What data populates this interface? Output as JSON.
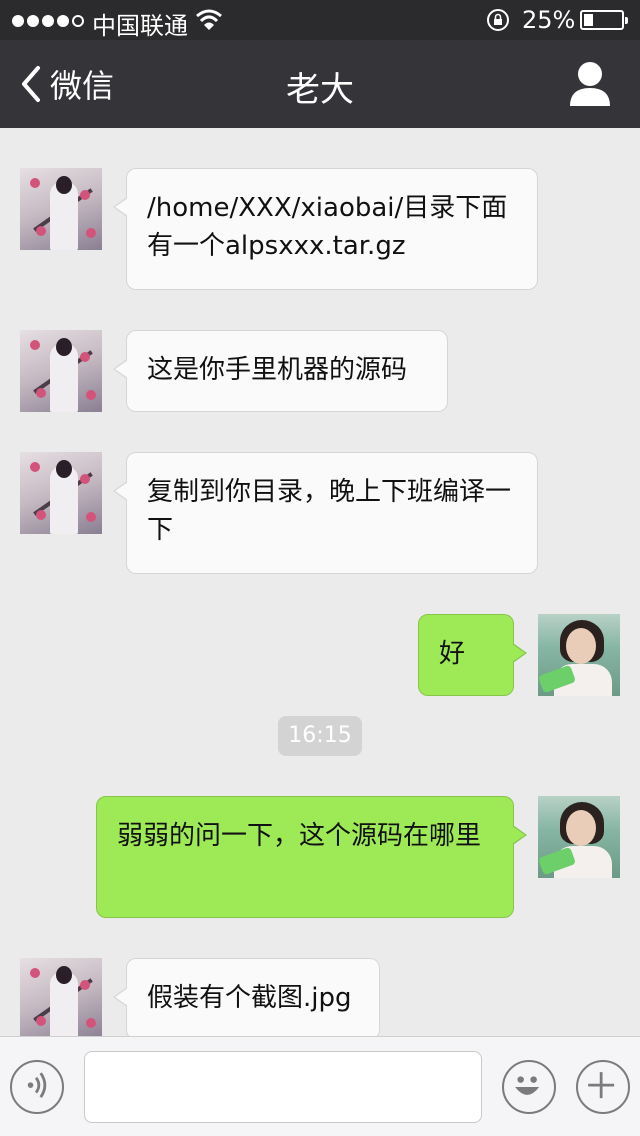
{
  "status": {
    "carrier": "中国联通",
    "battery_percent": "25%",
    "battery_level": 0.25,
    "signal_bars_filled": 4
  },
  "nav": {
    "back_label": "微信",
    "title": "老大",
    "back_icon": "chevron-left-icon",
    "profile_icon": "person-icon"
  },
  "messages": [
    {
      "side": "in",
      "text": "/home/XXX/xiaobai/目录下面有一个alpsxxx.tar.gz"
    },
    {
      "side": "in",
      "text": "这是你手里机器的源码"
    },
    {
      "side": "in",
      "text": "复制到你目录，晚上下班编译一下"
    },
    {
      "side": "out",
      "text": "好"
    },
    {
      "side": "time",
      "text": "16:15"
    },
    {
      "side": "out",
      "text": "弱弱的问一下，这个源码在哪里"
    },
    {
      "side": "in",
      "text": "假装有个截图.jpg"
    }
  ],
  "input": {
    "placeholder": "",
    "voice_icon": "voice-icon",
    "emoji_icon": "emoji-icon",
    "plus_icon": "plus-icon"
  },
  "colors": {
    "nav_bg": "#353539",
    "chat_bg": "#ebebeb",
    "out_bubble": "#9eea56",
    "in_bubble": "#fafafa"
  }
}
